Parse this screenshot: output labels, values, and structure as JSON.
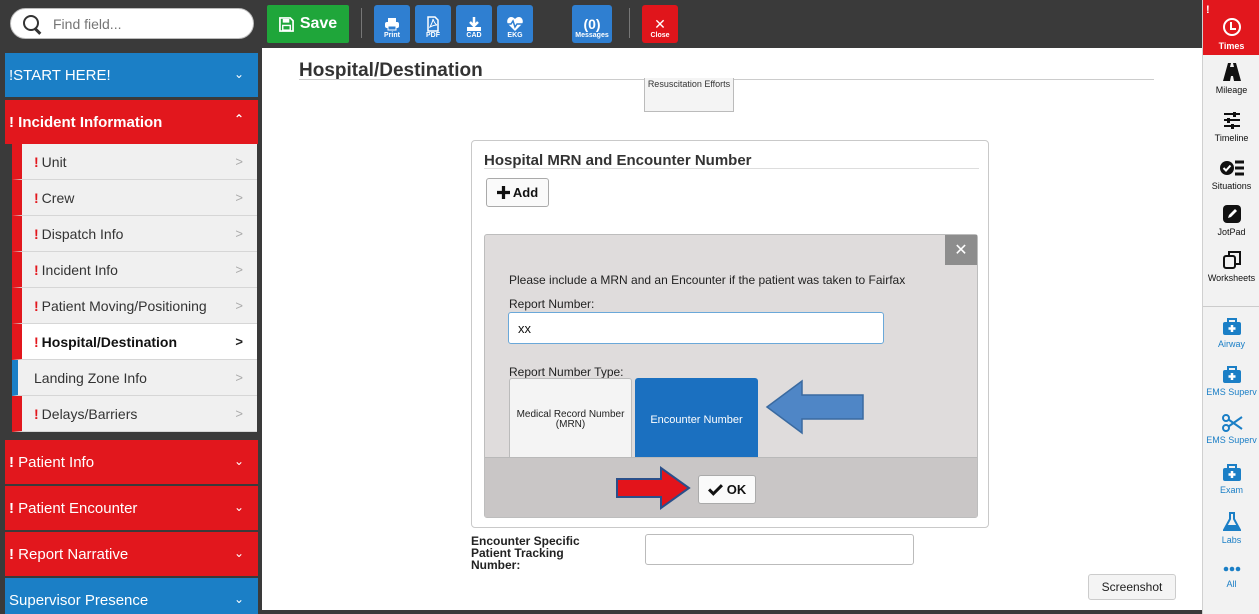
{
  "search": {
    "placeholder": "Find field..."
  },
  "toolbar": {
    "save_label": "Save",
    "buttons": [
      {
        "label": "Print",
        "icon": "print-icon"
      },
      {
        "label": "PDF",
        "icon": "pdf-icon"
      },
      {
        "label": "CAD",
        "icon": "download-icon"
      },
      {
        "label": "EKG",
        "icon": "heartbeat-icon"
      },
      {
        "label": "Messages",
        "count": "(0)"
      }
    ],
    "close_label": "Close"
  },
  "sidebar": {
    "start_here": "!START HERE!",
    "incident_information": "Incident Information",
    "items": [
      {
        "label": "Unit"
      },
      {
        "label": "Crew"
      },
      {
        "label": "Dispatch Info"
      },
      {
        "label": "Incident Info"
      },
      {
        "label": "Patient Moving/Positioning"
      },
      {
        "label": "Hospital/Destination"
      },
      {
        "label": "Landing Zone Info"
      },
      {
        "label": "Delays/Barriers"
      }
    ],
    "patient_info": "Patient Info",
    "patient_encounter": "Patient Encounter",
    "report_narrative": "Report Narrative",
    "supervisor_presence": "Supervisor Presence"
  },
  "main": {
    "page_title": "Hospital/Destination",
    "resuscitation_label": "Resuscitation Efforts",
    "mrn_section_title": "Hospital MRN and Encounter Number",
    "add_label": "Add",
    "modal": {
      "message": "Please include a MRN and an Encounter if the patient was taken to Fairfax",
      "report_number_label": "Report Number:",
      "report_number_value": "xx",
      "report_number_type_label": "Report Number Type:",
      "options": [
        "Medical Record Number (MRN)",
        "Encounter Number"
      ],
      "selected_option": "Encounter Number",
      "ok_label": "OK"
    },
    "encounter_label_lines": [
      "Encounter Specific",
      "Patient Tracking",
      "Number:"
    ],
    "screenshot_tooltip": "Screenshot"
  },
  "rail": {
    "items": [
      "Times",
      "Mileage",
      "Timeline",
      "Situations",
      "JotPad",
      "Worksheets",
      "Airway",
      "EMS Superv",
      "EMS Superv",
      "Exam",
      "Labs",
      "All"
    ]
  },
  "colors": {
    "save_green": "#1fa63a",
    "toolbar_blue": "#2f7fd1",
    "close_red": "#e2171d",
    "nav_blue": "#1b7fc6",
    "nav_red": "#e2171d",
    "selected_option_blue": "#1b70c0",
    "annotation_arrow_blue": "#4f86c6",
    "annotation_arrow_red": "#e3141b"
  }
}
